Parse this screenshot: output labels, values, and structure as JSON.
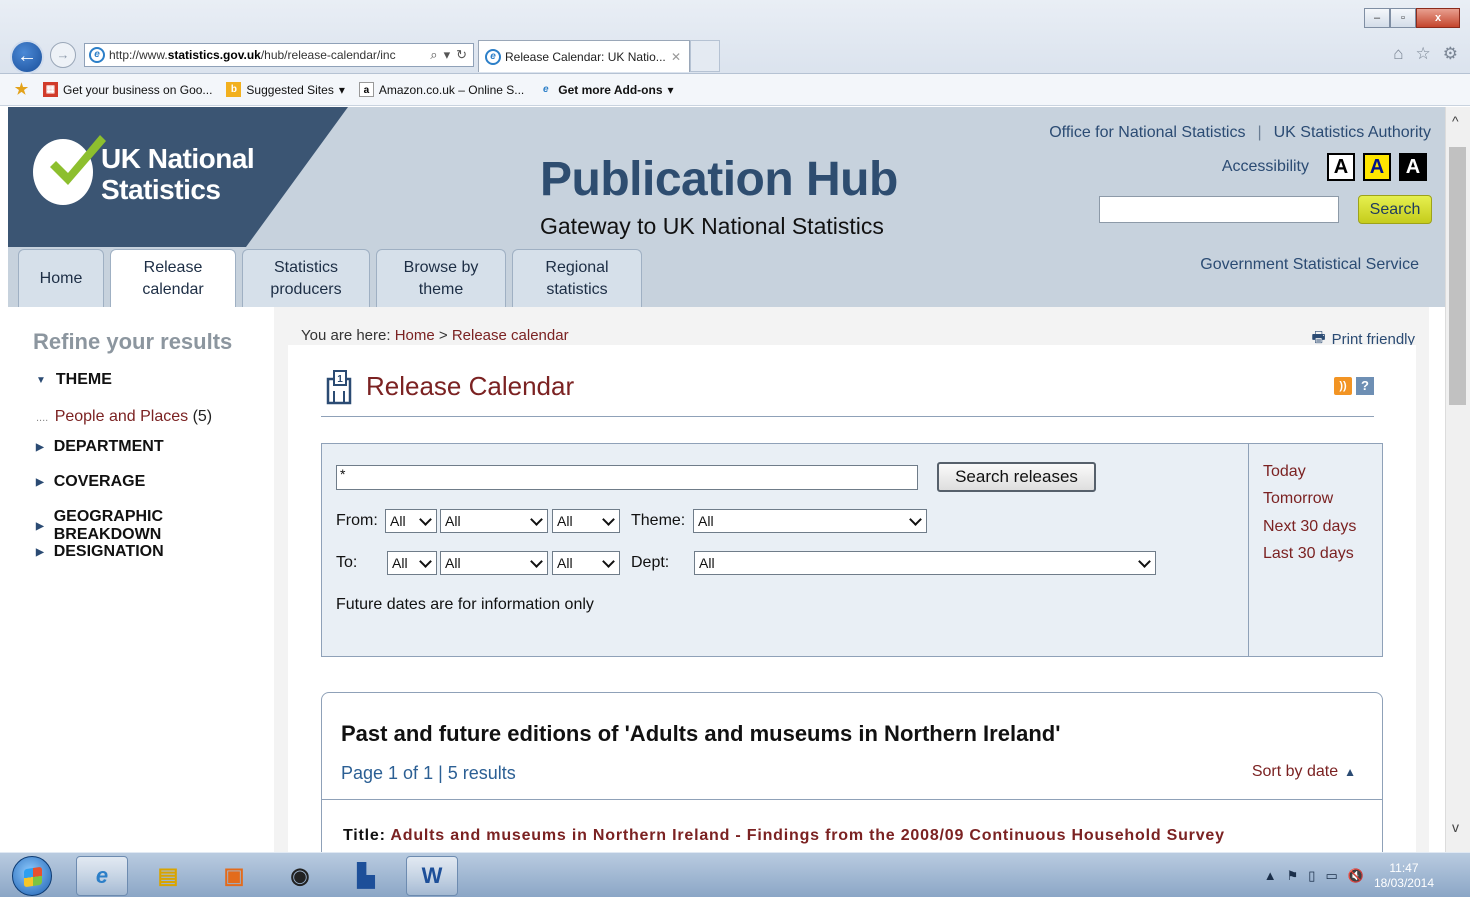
{
  "browser": {
    "url_prefix": "http://www.",
    "url_domain": "statistics.gov.uk",
    "url_rest": "/hub/release-calendar/inc",
    "tab_title": "Release Calendar: UK Natio...",
    "win_controls": [
      "–",
      "▫",
      "x"
    ],
    "favorites": [
      {
        "label": "Get your business on Goo...",
        "icon": "google-business-icon"
      },
      {
        "label": "Suggested Sites",
        "icon": "bing-icon",
        "dropdown": true
      },
      {
        "label": "Amazon.co.uk – Online S...",
        "icon": "amazon-icon"
      },
      {
        "label": "Get more Add-ons",
        "icon": "ie-icon",
        "dropdown": true
      }
    ]
  },
  "header": {
    "logo_line1": "UK National",
    "logo_line2": "Statistics",
    "title": "Publication Hub",
    "subtitle": "Gateway to UK National Statistics",
    "link_ons": "Office for National Statistics",
    "link_authority": "UK Statistics Authority",
    "accessibility": "Accessibility",
    "acc_letter": "A",
    "search_btn": "Search",
    "gss": "Government Statistical Service"
  },
  "nav": [
    {
      "label": "Home"
    },
    {
      "label": "Release calendar"
    },
    {
      "label": "Statistics producers"
    },
    {
      "label": "Browse by theme"
    },
    {
      "label": "Regional statistics"
    }
  ],
  "sidebar": {
    "title": "Refine your results",
    "facets": [
      "THEME",
      "DEPARTMENT",
      "COVERAGE",
      "GEOGRAPHIC BREAKDOWN",
      "DESIGNATION"
    ],
    "theme_item": "People and Places",
    "theme_count": "(5)"
  },
  "breadcrumb": {
    "prefix": "You are here:",
    "home": "Home",
    "sep": ">",
    "current": "Release calendar"
  },
  "print_friendly": "Print friendly",
  "release_calendar": {
    "title": "Release Calendar",
    "search_value": "*",
    "search_btn": "Search releases",
    "from_label": "From:",
    "to_label": "To:",
    "theme_label": "Theme:",
    "dept_label": "Dept:",
    "from_day": "All",
    "from_month": "All",
    "from_year": "All",
    "to_day": "All",
    "to_month": "All",
    "to_year": "All",
    "theme_value": "All",
    "dept_value": "All",
    "note": "Future dates are for information only",
    "quick_links": [
      "Today",
      "Tomorrow",
      "Next 30 days",
      "Last 30 days"
    ]
  },
  "results": {
    "title": "Past and future editions of 'Adults and museums in Northern Ireland'",
    "page_info": "Page 1 of 1 | 5 results",
    "sort": "Sort by date",
    "row_label": "Title:",
    "row_title": "Adults and museums in Northern Ireland - Findings from the 2008/09 Continuous Household Survey"
  },
  "taskbar": {
    "time": "11:47",
    "date": "18/03/2014"
  }
}
